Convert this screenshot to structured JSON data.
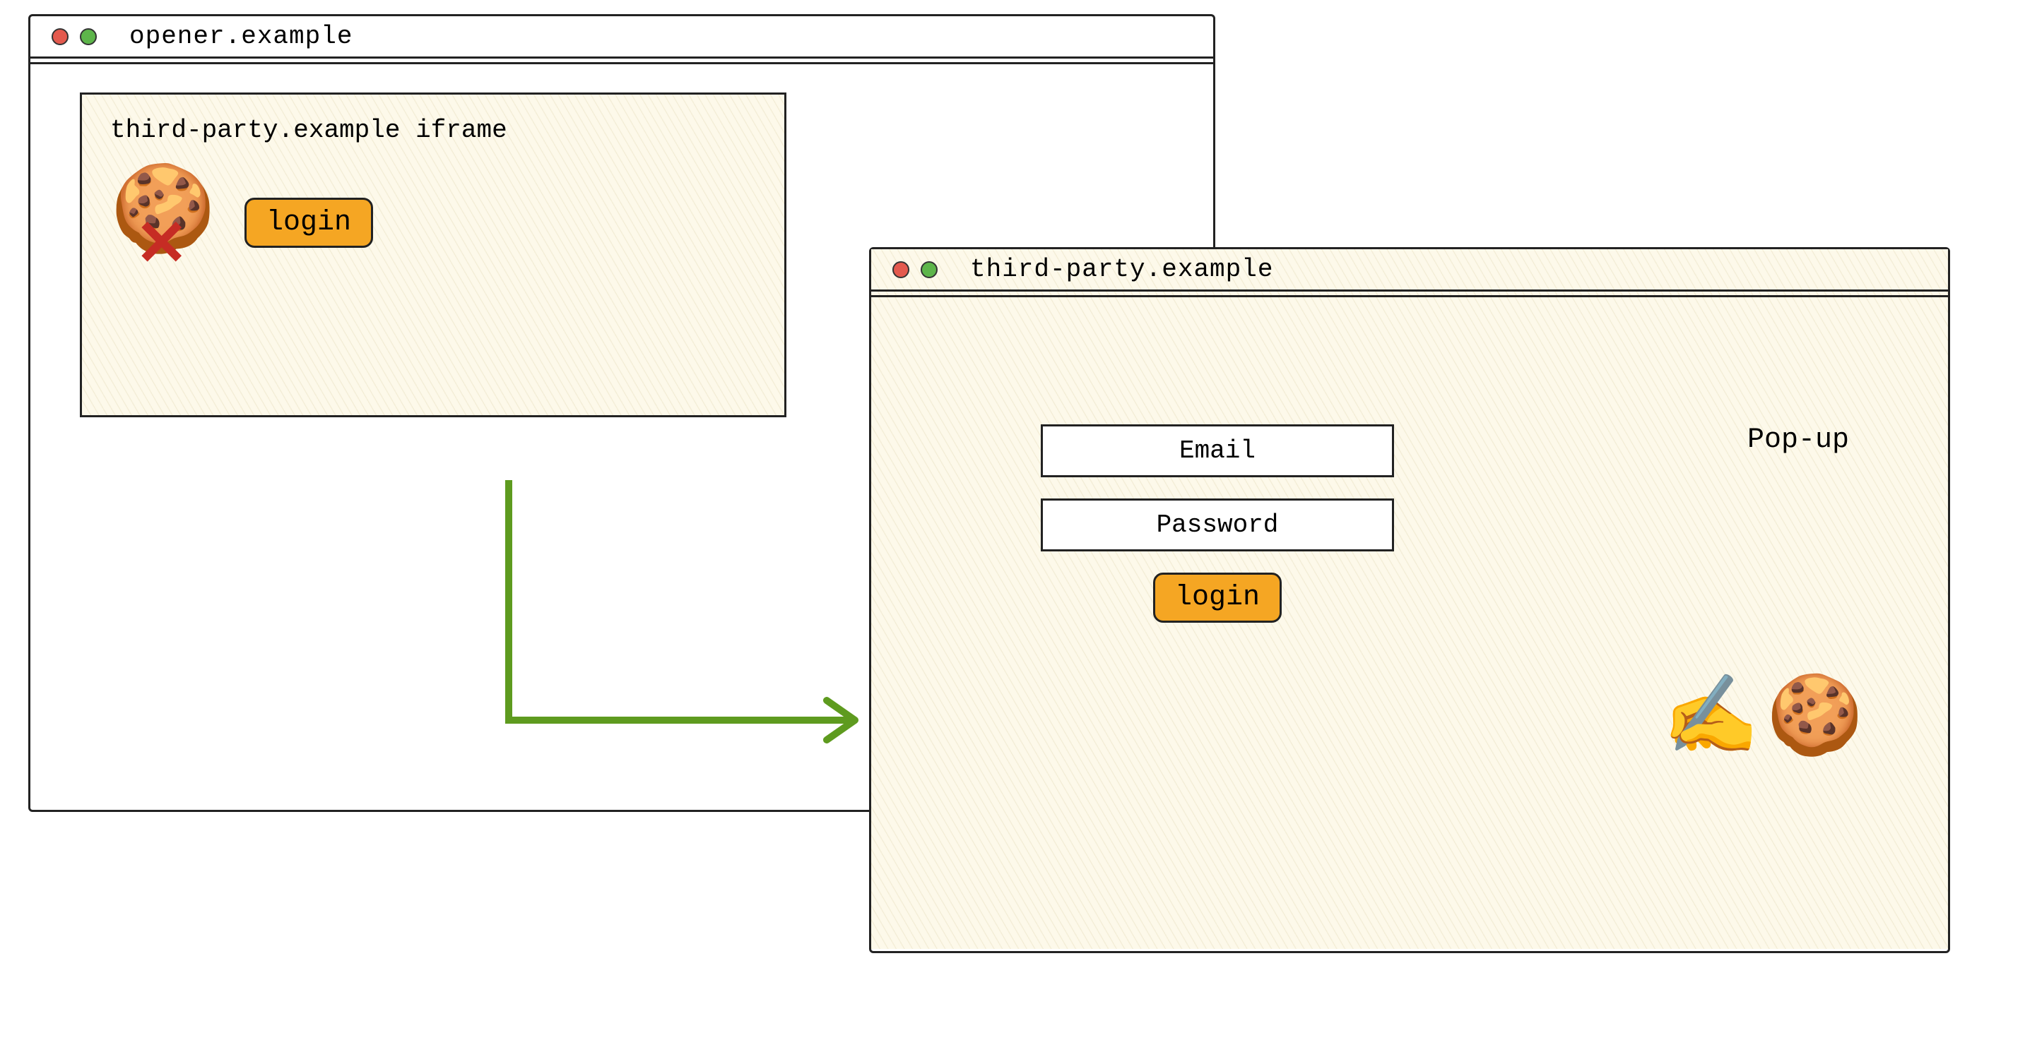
{
  "opener": {
    "title": "opener.example",
    "iframe": {
      "label": "third-party.example iframe",
      "login_button": "login",
      "cookie_icon": "🍪",
      "cross_icon": "✕"
    }
  },
  "popup": {
    "title": "third-party.example",
    "label": "Pop-up",
    "email_placeholder": "Email",
    "password_placeholder": "Password",
    "login_button": "login",
    "writing_icon": "✍️",
    "cookie_icon": "🍪"
  },
  "arrow": {
    "color": "#5e9b1f"
  }
}
